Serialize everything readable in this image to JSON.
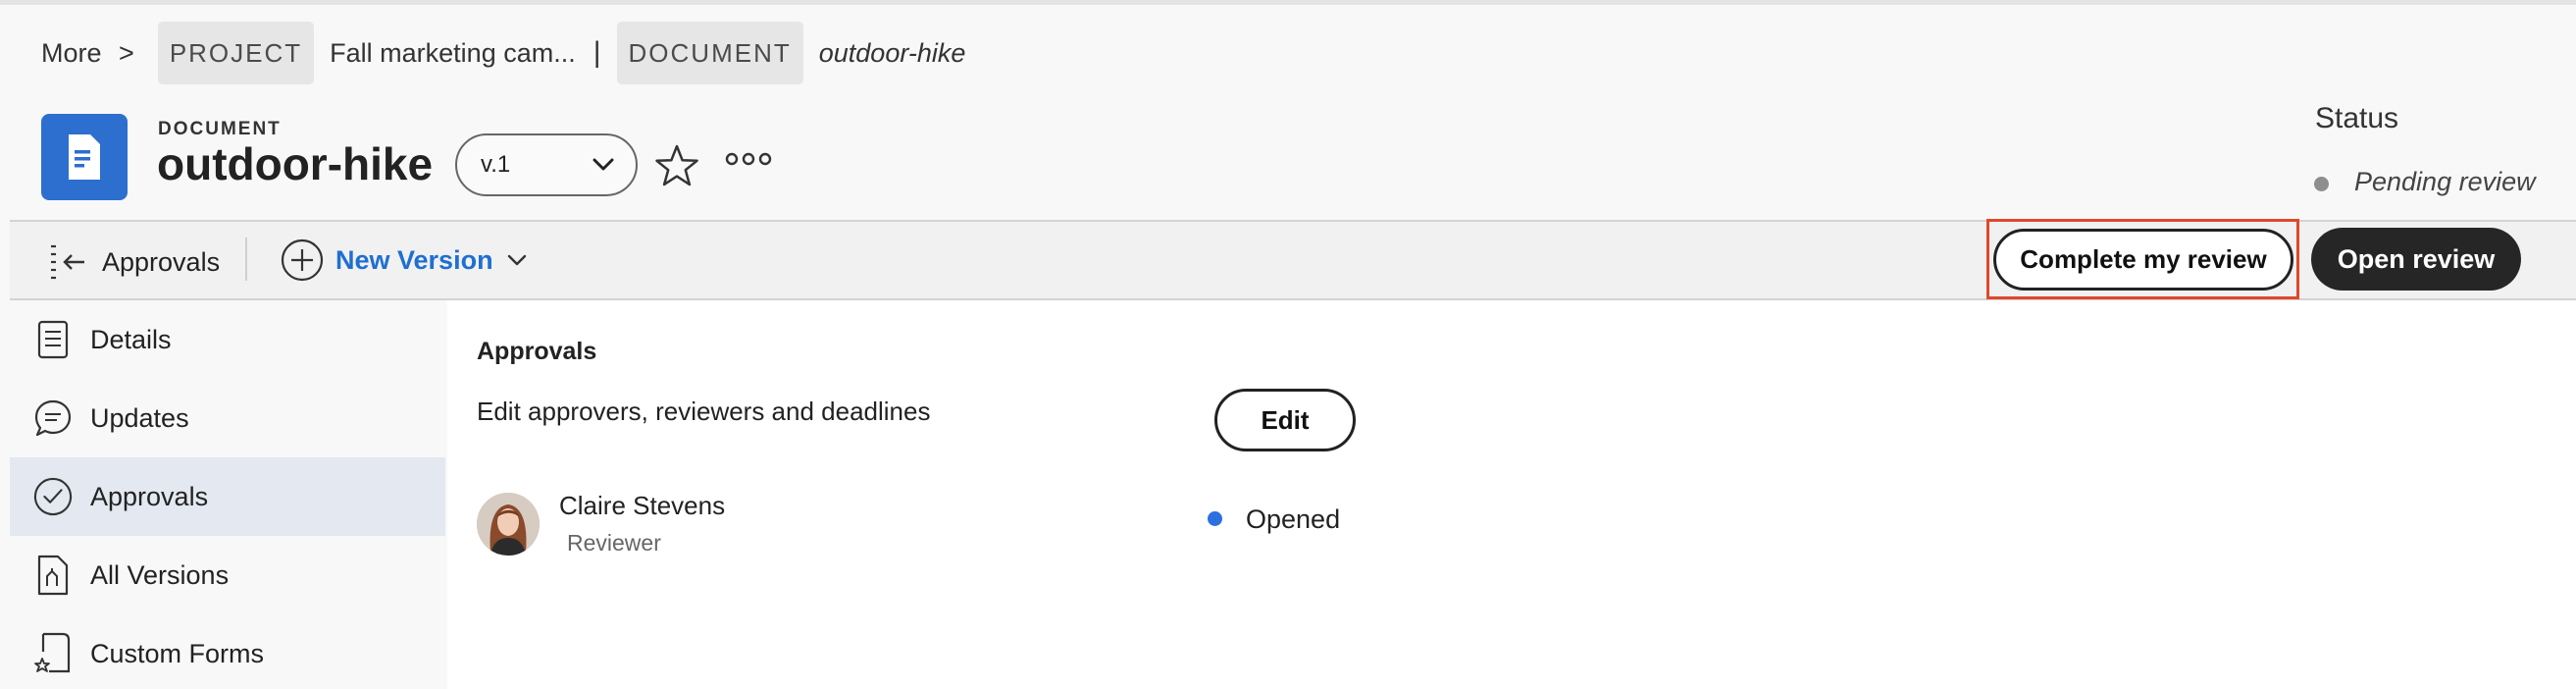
{
  "breadcrumb": {
    "more": "More",
    "more_chevron": ">",
    "project_tag": "PROJECT",
    "project_name": "Fall marketing cam...",
    "separator": "|",
    "document_tag": "DOCUMENT",
    "document_name": "outdoor-hike"
  },
  "header": {
    "kicker": "DOCUMENT",
    "title": "outdoor-hike",
    "version": "v.1",
    "icon": "document-icon",
    "accent_color": "#2c6fce"
  },
  "status": {
    "label": "Status",
    "value": "Pending review",
    "dot_color": "#8e8e8e"
  },
  "toolbar": {
    "approvals_label": "Approvals",
    "new_version_label": "New Version",
    "complete_review_label": "Complete my review",
    "open_review_label": "Open review"
  },
  "sidebar": {
    "items": [
      {
        "label": "Details",
        "icon": "details-icon",
        "active": false
      },
      {
        "label": "Updates",
        "icon": "chat-bubble-icon",
        "active": false
      },
      {
        "label": "Approvals",
        "icon": "check-circle-icon",
        "active": true
      },
      {
        "label": "All Versions",
        "icon": "versions-icon",
        "active": false
      },
      {
        "label": "Custom Forms",
        "icon": "form-star-icon",
        "active": false
      }
    ]
  },
  "main": {
    "heading": "Approvals",
    "description": "Edit approvers, reviewers and deadlines",
    "edit_label": "Edit",
    "reviewer": {
      "name": "Claire Stevens",
      "role": "Reviewer",
      "status": "Opened",
      "status_color": "#2c6fe0"
    }
  }
}
